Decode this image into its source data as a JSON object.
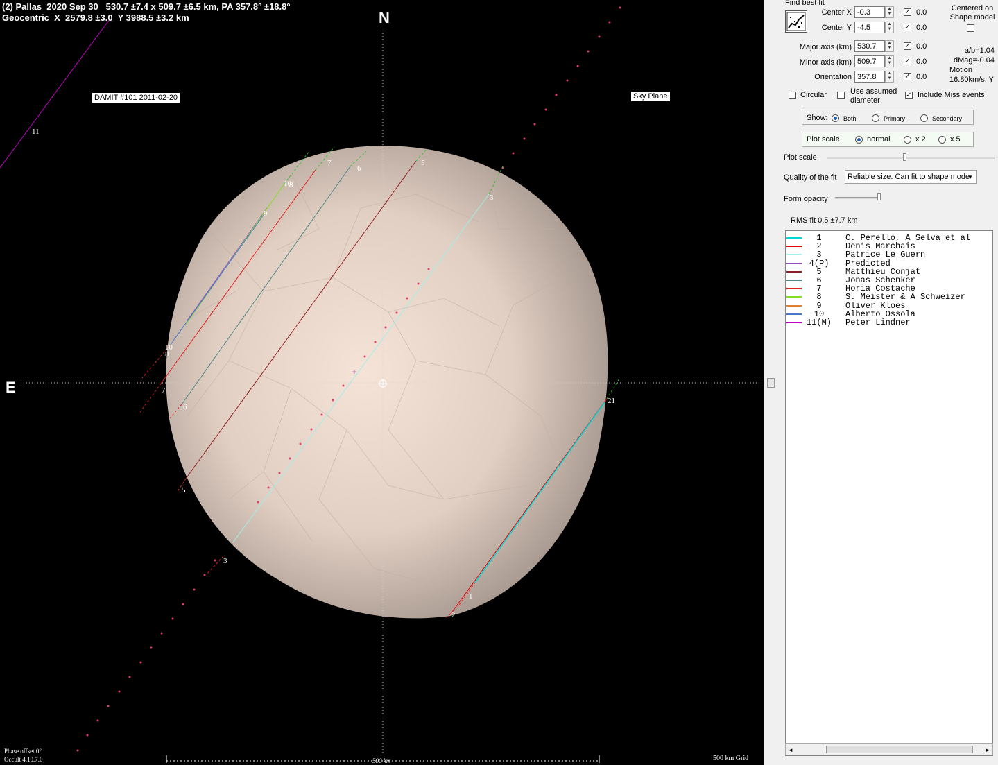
{
  "header": {
    "line1": "(2) Pallas  2020 Sep 30   530.7 ±7.4 x 509.7 ±6.5 km, PA 357.8° ±18.8°",
    "line2": "Geocentric  X  2579.8 ±3.0  Y 3988.5 ±3.2 km"
  },
  "plot": {
    "north_label": "N",
    "east_label": "E",
    "damit_label": "DAMIT #101 2011-02-20",
    "sky_plane_label": "Sky Plane",
    "phase_offset": "Phase offset 0°",
    "version": "Occult 4.10.7.0",
    "scale_bar_label": "500 km",
    "grid_label": "500 km Grid",
    "chord_labels": [
      "11",
      "7",
      "6",
      "5",
      "3",
      "10",
      "8",
      "9",
      "10",
      "8",
      "7",
      "6",
      "5",
      "3",
      "1",
      "2",
      "21"
    ],
    "colors": {
      "background": "#000000",
      "shape": "#d8c6bb",
      "chord_red": "#e02020",
      "chord_cyan": "#7fe3dd"
    }
  },
  "panel": {
    "find_best_fit_label": "Find best fit",
    "center_x_label": "Center X",
    "center_x_value": "-0.3",
    "center_x_unc": "0.0",
    "center_y_label": "Center Y",
    "center_y_value": "-4.5",
    "center_y_unc": "0.0",
    "centered_on_label": "Centered on\nShape model",
    "major_axis_label": "Major axis (km)",
    "major_axis_value": "530.7",
    "major_axis_unc": "0.0",
    "minor_axis_label": "Minor axis (km)",
    "minor_axis_value": "509.7",
    "minor_axis_unc": "0.0",
    "orientation_label": "Orientation",
    "orientation_value": "357.8",
    "orientation_unc": "0.0",
    "ab_ratio": "a/b=1.04",
    "dmag": "dMag=-0.04",
    "motion_label": "Motion",
    "motion_value": "16.80km/s, Y",
    "circular_label": "Circular",
    "use_assumed_label": "Use assumed\ndiameter",
    "include_miss_label": "Include Miss events",
    "show_label": "Show:",
    "show_options": [
      "Both",
      "Primary",
      "Secondary"
    ],
    "plot_scale_group_label": "Plot scale",
    "plot_scale_options": [
      "normal",
      "x 2",
      "x 5"
    ],
    "plot_scale_slider_label": "Plot scale",
    "quality_label": "Quality of the fit",
    "quality_value": "Reliable size. Can fit to shape mode",
    "form_opacity_label": "Form opacity",
    "rms_fit": "RMS fit 0.5 ±7.7 km"
  },
  "legend": [
    {
      "num": "1",
      "name": "C. Perello, A Selva et al",
      "color": "#00d8d8"
    },
    {
      "num": "2",
      "name": "Denis Marchais",
      "color": "#e00000"
    },
    {
      "num": "3",
      "name": "Patrice Le Guern",
      "color": "#9ff0ea"
    },
    {
      "num": "4(P)",
      "name": "Predicted",
      "color": "#9050c0"
    },
    {
      "num": "5",
      "name": "Matthieu Conjat",
      "color": "#902020"
    },
    {
      "num": "6",
      "name": "Jonas Schenker",
      "color": "#508888"
    },
    {
      "num": "7",
      "name": "Horia Costache",
      "color": "#e02020"
    },
    {
      "num": "8",
      "name": "S. Meister & A Schweizer",
      "color": "#80e020"
    },
    {
      "num": "9",
      "name": "Oliver Kloes",
      "color": "#e08030"
    },
    {
      "num": "10",
      "name": "Alberto Ossola",
      "color": "#4878c8"
    },
    {
      "num": "11(M)",
      "name": "Peter Lindner",
      "color": "#c000c0"
    }
  ]
}
